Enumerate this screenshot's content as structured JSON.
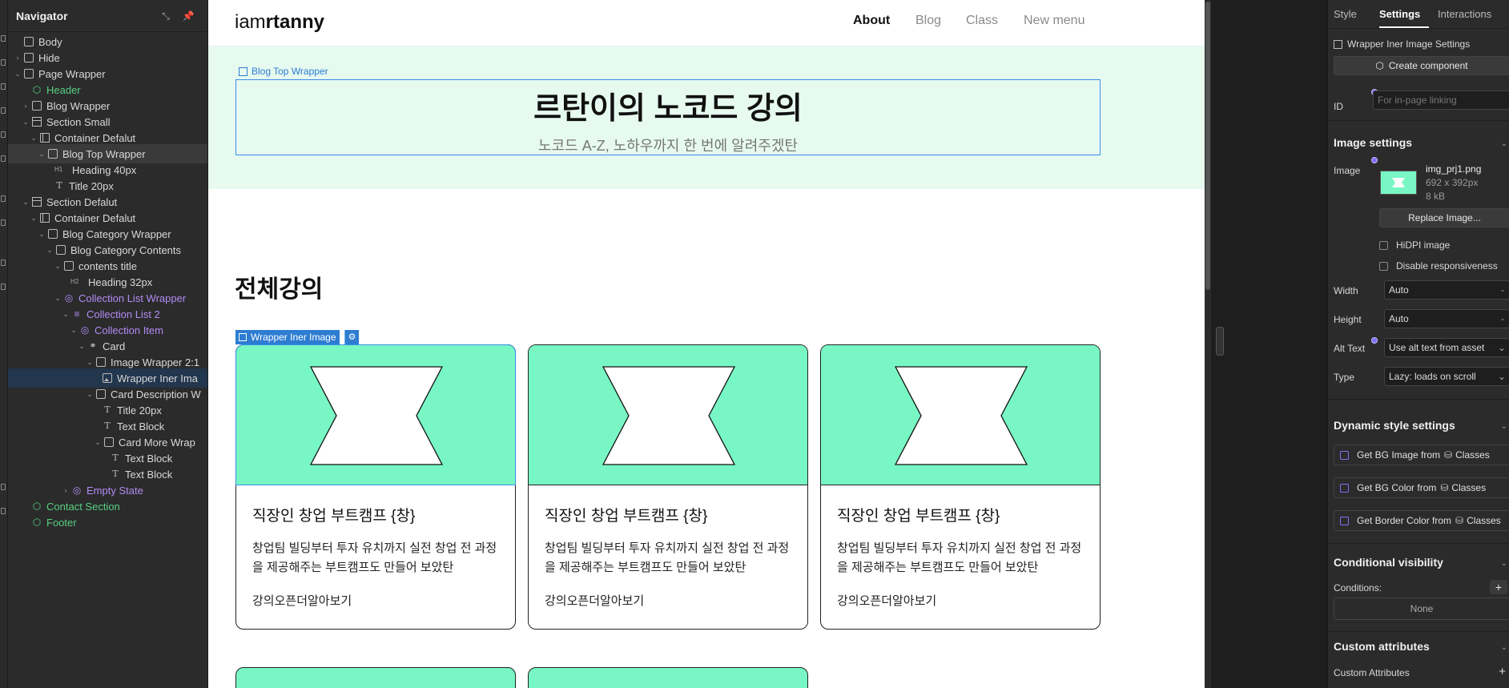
{
  "navigator": {
    "title": "Navigator",
    "tree": [
      {
        "label": "Body"
      },
      {
        "label": "Hide"
      },
      {
        "label": "Page Wrapper"
      },
      {
        "label": "Header"
      },
      {
        "label": "Blog Wrapper"
      },
      {
        "label": "Section Small"
      },
      {
        "label": "Container Defalut"
      },
      {
        "label": "Blog Top Wrapper"
      },
      {
        "label": "Heading 40px",
        "tag": "H1"
      },
      {
        "label": "Title 20px"
      },
      {
        "label": "Section Defalut"
      },
      {
        "label": "Container Defalut"
      },
      {
        "label": "Blog Category Wrapper"
      },
      {
        "label": "Blog Category Contents"
      },
      {
        "label": "contents title"
      },
      {
        "label": "Heading 32px",
        "tag": "H2"
      },
      {
        "label": "Collection List Wrapper"
      },
      {
        "label": "Collection List 2"
      },
      {
        "label": "Collection Item"
      },
      {
        "label": "Card"
      },
      {
        "label": "Image Wrapper 2:1"
      },
      {
        "label": "Wrapper Iner Ima"
      },
      {
        "label": "Card Description W"
      },
      {
        "label": "Title 20px"
      },
      {
        "label": "Text Block"
      },
      {
        "label": "Card More Wrap"
      },
      {
        "label": "Text Block"
      },
      {
        "label": "Text Block"
      },
      {
        "label": "Empty State"
      },
      {
        "label": "Contact Section"
      },
      {
        "label": "Footer"
      }
    ]
  },
  "site": {
    "logo_light": "iam",
    "logo_bold": "rtanny",
    "menu": [
      "About",
      "Blog",
      "Class",
      "New menu"
    ],
    "top_wrapper_label": "Blog Top Wrapper",
    "hero_title": "르탄이의 노코드 강의",
    "hero_subtitle": "노코드 A-Z, 노하우까지 한 번에 알려주겠탄",
    "section_title": "전체강의",
    "selected_label": "Wrapper Iner Image",
    "cards": [
      {
        "title": "직장인 창업 부트캠프 {창}",
        "desc": "창업팀 빌딩부터 투자 유치까지 실전 창업 전 과정을 제공해주는 부트캠프도 만들어 보았탄",
        "more": "강의오픈더알아보기"
      },
      {
        "title": "직장인 창업 부트캠프 {창}",
        "desc": "창업팀 빌딩부터 투자 유치까지 실전 창업 전 과정을 제공해주는 부트캠프도 만들어 보았탄",
        "more": "강의오픈더알아보기"
      },
      {
        "title": "직장인 창업 부트캠프 {창}",
        "desc": "창업팀 빌딩부터 투자 유치까지 실전 창업 전 과정을 제공해주는 부트캠프도 만들어 보았탄",
        "more": "강의오픈더알아보기"
      }
    ]
  },
  "panel": {
    "tabs": [
      "Style",
      "Settings",
      "Interactions"
    ],
    "element_settings": "Wrapper Iner Image Settings",
    "create_component": "Create component",
    "id_label": "ID",
    "id_placeholder": "For in-page linking",
    "image_settings": "Image settings",
    "image_label": "Image",
    "image_name": "img_prj1.png",
    "image_dims": "692 x 392px",
    "image_size": "8 kB",
    "replace": "Replace Image...",
    "hidpi": "HiDPI image",
    "disable_resp": "Disable responsiveness",
    "width_label": "Width",
    "width_value": "Auto",
    "height_label": "Height",
    "height_value": "Auto",
    "alt_label": "Alt Text",
    "alt_value": "Use alt text from asset",
    "type_label": "Type",
    "type_value": "Lazy: loads on scroll",
    "dynamic_title": "Dynamic style settings",
    "dyn_items": [
      "Get BG Image from",
      "Get BG Color from",
      "Get Border Color from"
    ],
    "dyn_classes": "Classes",
    "cond_title": "Conditional visibility",
    "conditions_label": "Conditions:",
    "conditions_value": "None",
    "custom_attr_title": "Custom attributes",
    "custom_attr_label": "Custom Attributes"
  },
  "colors": {
    "accent": "#3b8ee5",
    "mint": "#78f7c4",
    "hero_bg": "#e6faf0",
    "component_green": "#56d081",
    "collection_purple": "#b18cf5"
  }
}
